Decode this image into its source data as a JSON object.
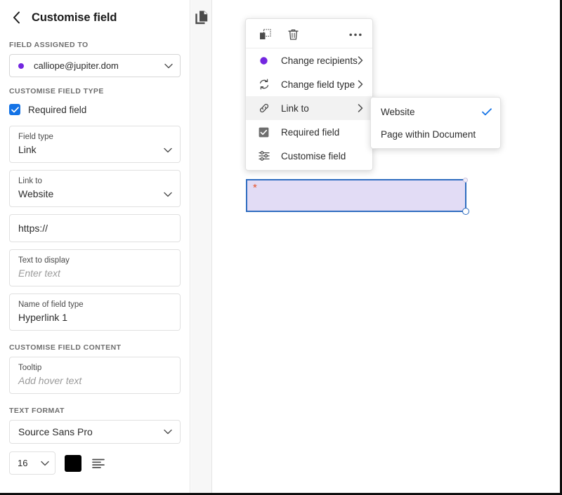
{
  "sidebar": {
    "back_icon": "chevron-left-icon",
    "title": "Customise field",
    "assigned_section_label": "FIELD ASSIGNED TO",
    "assigned_recipient": "calliope@jupiter.dom",
    "customise_type_label": "CUSTOMISE FIELD TYPE",
    "required_field_label": "Required field",
    "required_field_checked": true,
    "fields": [
      {
        "label": "Field type",
        "value": "Link",
        "type": "select"
      },
      {
        "label": "Link to",
        "value": "Website",
        "type": "select"
      },
      {
        "label": "",
        "value": "https://",
        "type": "text"
      },
      {
        "label": "Text to display",
        "value": "Enter text",
        "type": "placeholder"
      },
      {
        "label": "Name of field type",
        "value": "Hyperlink 1",
        "type": "text"
      }
    ],
    "customise_content_label": "CUSTOMISE FIELD CONTENT",
    "tooltip_label": "Tooltip",
    "tooltip_placeholder": "Add hover text",
    "text_format_label": "TEXT FORMAT",
    "font_family": "Source Sans Pro",
    "font_size": "16",
    "text_color": "#000000",
    "align_icon": "align-left-icon"
  },
  "gutter": {
    "duplicate_pages_icon": "duplicate-pages-icon"
  },
  "context_menu": {
    "toolbar": [
      {
        "icon": "duplicate-icon",
        "name": "duplicate-field-button"
      },
      {
        "icon": "trash-icon",
        "name": "delete-field-button"
      },
      {
        "icon": "ellipsis-icon",
        "name": "more-options-button"
      }
    ],
    "items": [
      {
        "label": "Change recipients",
        "icon": "recipient-dot-icon",
        "submenu": true,
        "highlight": false
      },
      {
        "label": "Change field type",
        "icon": "sync-icon",
        "submenu": true,
        "highlight": false
      },
      {
        "label": "Link to",
        "icon": "link-icon",
        "submenu": true,
        "highlight": true
      },
      {
        "label": "Required field",
        "icon": "checkbox-checked-icon",
        "submenu": false,
        "highlight": false
      },
      {
        "label": "Customise field",
        "icon": "sliders-icon",
        "submenu": false,
        "highlight": false
      }
    ]
  },
  "submenu": {
    "items": [
      {
        "label": "Website",
        "checked": true
      },
      {
        "label": "Page within Document",
        "checked": false
      }
    ],
    "check_icon": "checkmark-icon",
    "check_color": "#1473e6"
  },
  "document_field": {
    "required_marker": "*",
    "fill_color": "#e2dcf5",
    "border_color": "#2f6dc0",
    "marker_color": "#e8542a"
  },
  "colors": {
    "accent_blue": "#1473e6",
    "recipient_purple": "#7326e0",
    "field_border": "#2f6dc0"
  }
}
